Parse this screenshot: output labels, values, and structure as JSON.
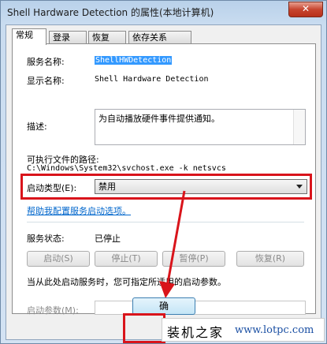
{
  "window": {
    "title": "Shell Hardware Detection 的属性(本地计算机)",
    "close_label": "✕"
  },
  "tabs": [
    {
      "label": "常规"
    },
    {
      "label": "登录"
    },
    {
      "label": "恢复"
    },
    {
      "label": "依存关系"
    }
  ],
  "general": {
    "service_name_label": "服务名称:",
    "service_name_value": "ShellHWDetection",
    "display_name_label": "显示名称:",
    "display_name_value": "Shell Hardware Detection",
    "description_label": "描述:",
    "description_value": "为自动播放硬件事件提供通知。",
    "exe_path_label": "可执行文件的路径:",
    "exe_path_value": "C:\\Windows\\System32\\svchost.exe -k netsvcs",
    "startup_type_label": "启动类型(E):",
    "startup_type_value": "禁用",
    "help_link": "帮助我配置服务启动选项。",
    "status_label": "服务状态:",
    "status_value": "已停止",
    "buttons": {
      "start": "启动(S)",
      "stop": "停止(T)",
      "pause": "暂停(P)",
      "resume": "恢复(R)"
    },
    "hint": "当从此处启动服务时，您可指定所适用的启动参数。",
    "start_params_label": "启动参数(M):",
    "start_params_value": ""
  },
  "footer": {
    "ok_label": "确"
  },
  "watermark": {
    "text": "装机之家",
    "url": "www.lotpc.com"
  },
  "colors": {
    "highlight_red": "#d9141b",
    "link_blue": "#0066cc",
    "selection_blue": "#3399ff"
  }
}
